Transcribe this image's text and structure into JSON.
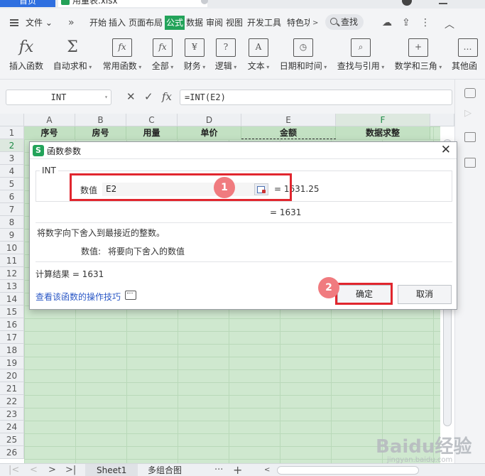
{
  "titlebar": {
    "home_tab": "首页",
    "file_tab": "用量表.xlsx"
  },
  "menubar": {
    "file_menu": "文件",
    "tabs": [
      "开始",
      "插入",
      "页面布局",
      "公式",
      "数据",
      "审阅",
      "视图",
      "开发工具",
      "特色功"
    ],
    "active_tab": "公式",
    "search": "查找"
  },
  "ribbon": {
    "buttons": [
      {
        "label": "插入函数",
        "icon": "fx-icon"
      },
      {
        "label": "自动求和",
        "icon": "sigma-icon"
      },
      {
        "label": "常用函数",
        "icon": "star-fx-icon"
      },
      {
        "label": "全部",
        "icon": "fx-book-icon"
      },
      {
        "label": "财务",
        "icon": "yen-icon"
      },
      {
        "label": "逻辑",
        "icon": "question-icon"
      },
      {
        "label": "文本",
        "icon": "text-a-icon"
      },
      {
        "label": "日期和时间",
        "icon": "clock-icon"
      },
      {
        "label": "查找与引用",
        "icon": "lookup-icon"
      },
      {
        "label": "数学和三角",
        "icon": "math-icon"
      },
      {
        "label": "其他函",
        "icon": "more-fx-icon"
      }
    ]
  },
  "formula_bar": {
    "name_box": "INT",
    "formula": "=INT(E2)"
  },
  "sheet": {
    "columns": [
      "A",
      "B",
      "C",
      "D",
      "E",
      "F"
    ],
    "rows": [
      "1",
      "2",
      "3",
      "4",
      "5",
      "6",
      "7",
      "8",
      "9",
      "10",
      "11",
      "12",
      "13",
      "14",
      "15",
      "16",
      "17",
      "18",
      "19",
      "20",
      "21",
      "22",
      "23",
      "24",
      "25",
      "26"
    ],
    "header_cells": [
      "序号",
      "房号",
      "用量",
      "单价",
      "金额",
      "数据求整"
    ]
  },
  "sheet_tabs": {
    "tabs": [
      "Sheet1",
      "多组合图"
    ],
    "active": "Sheet1"
  },
  "dialog": {
    "title": "函数参数",
    "function_name": "INT",
    "arg_label": "数值",
    "arg_value": "E2",
    "arg_result": "= 1631.25",
    "function_result": "= 1631",
    "description": "将数字向下舍入到最接近的整数。",
    "arg_desc_name": "数值:",
    "arg_desc_text": "将要向下舍入的数值",
    "calc_result": "计算结果 =  1631",
    "help_link": "查看该函数的操作技巧",
    "ok": "确定",
    "cancel": "取消"
  },
  "annotations": {
    "step1": "1",
    "step2": "2"
  },
  "watermark": {
    "main": "Baidu经验",
    "sub": "jingyan.baidu.com"
  }
}
